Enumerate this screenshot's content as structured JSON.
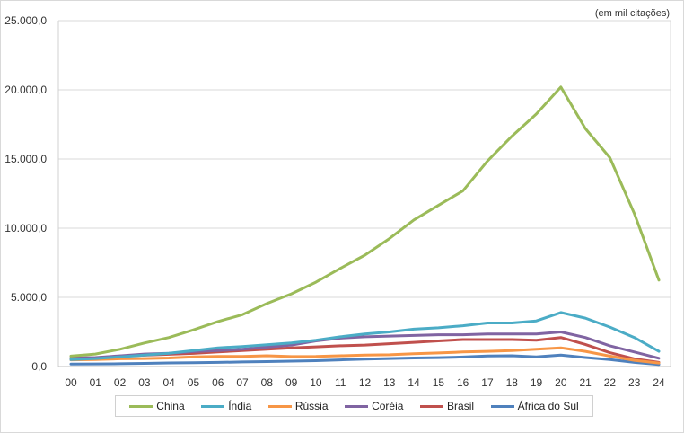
{
  "chart_data": {
    "type": "line",
    "title": "",
    "xlabel": "",
    "ylabel": "",
    "unit_note": "(em mil citações)",
    "ylim": [
      0,
      25000
    ],
    "yticks": [
      "0,0",
      "5.000,0",
      "10.000,0",
      "15.000,0",
      "20.000,0",
      "25.000,0"
    ],
    "ytick_values": [
      0,
      5000,
      10000,
      15000,
      20000,
      25000
    ],
    "grid": "horizontal",
    "legend_position": "bottom",
    "categories": [
      "00",
      "01",
      "02",
      "03",
      "04",
      "05",
      "06",
      "07",
      "08",
      "09",
      "10",
      "11",
      "12",
      "13",
      "14",
      "15",
      "16",
      "17",
      "18",
      "19",
      "20",
      "21",
      "22",
      "23",
      "24"
    ],
    "series": [
      {
        "name": "China",
        "color": "#9bbb59",
        "values": [
          750,
          900,
          1250,
          1700,
          2100,
          2650,
          3250,
          3750,
          4550,
          5250,
          6100,
          7100,
          8050,
          9250,
          10600,
          11650,
          12700,
          14850,
          16650,
          18250,
          20200,
          17200,
          15100,
          11050,
          6250
        ]
      },
      {
        "name": "Índia",
        "color": "#4bacc6",
        "values": [
          500,
          580,
          700,
          830,
          960,
          1150,
          1350,
          1450,
          1580,
          1700,
          1900,
          2150,
          2350,
          2500,
          2700,
          2800,
          2950,
          3150,
          3150,
          3300,
          3900,
          3500,
          2850,
          2100,
          1100
        ]
      },
      {
        "name": "Rússia",
        "color": "#f79646",
        "values": [
          480,
          500,
          560,
          580,
          620,
          700,
          730,
          730,
          780,
          720,
          730,
          780,
          830,
          850,
          920,
          980,
          1050,
          1100,
          1150,
          1250,
          1350,
          1100,
          750,
          450,
          250
        ]
      },
      {
        "name": "Coréia",
        "color": "#8064a2",
        "values": [
          620,
          650,
          770,
          900,
          960,
          1080,
          1150,
          1250,
          1400,
          1550,
          1850,
          2050,
          2150,
          2200,
          2250,
          2300,
          2300,
          2350,
          2350,
          2350,
          2500,
          2100,
          1500,
          1050,
          600
        ]
      },
      {
        "name": "Brasil",
        "color": "#c0504d",
        "values": [
          560,
          630,
          750,
          820,
          880,
          950,
          1050,
          1150,
          1250,
          1350,
          1420,
          1500,
          1550,
          1650,
          1750,
          1850,
          1950,
          1950,
          1950,
          1900,
          2100,
          1600,
          1000,
          550,
          300
        ]
      },
      {
        "name": "África do Sul",
        "color": "#4f81bd",
        "values": [
          180,
          190,
          200,
          230,
          260,
          280,
          300,
          330,
          360,
          390,
          420,
          480,
          530,
          580,
          620,
          640,
          690,
          760,
          780,
          700,
          830,
          650,
          500,
          300,
          150
        ]
      }
    ]
  }
}
